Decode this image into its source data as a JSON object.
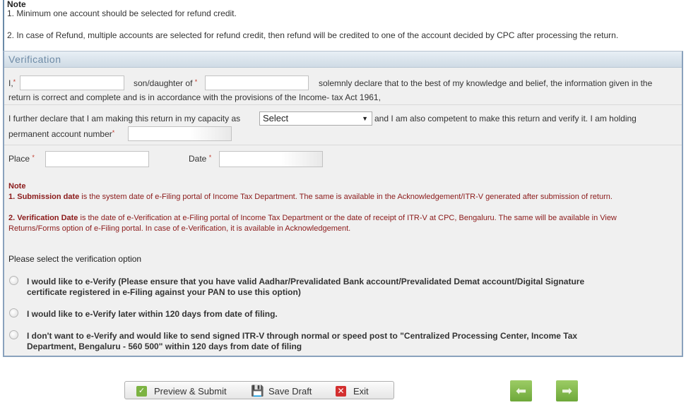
{
  "top_note": {
    "title": "Note",
    "lines": [
      "1. Minimum one account should be selected for refund credit.",
      "2. In case of Refund, multiple accounts are selected for refund credit, then refund will be credited to one of the account decided by CPC after processing the return."
    ]
  },
  "verification": {
    "header": "Verification",
    "declaration": {
      "i_label": "I,",
      "son_daughter_label": "son/daughter of",
      "solemnly_text": "solemnly declare that to the best of my knowledge and belief, the information given in the",
      "line2": "return is correct and complete and is in accordance with the provisions of the Income- tax Act 1961,",
      "name_value": "",
      "parent_value": ""
    },
    "capacity": {
      "text_before": "I further declare that I am making this return in my capacity as",
      "select_value": "Select",
      "text_after": "and I am also competent to make this return and verify it. I am holding",
      "pan_label": "permanent account number",
      "pan_value": ""
    },
    "place_label": "Place",
    "place_value": "",
    "date_label": "Date",
    "date_value": "",
    "required_marker": "*",
    "note": {
      "title": "Note",
      "item1_bold": "1. Submission date",
      "item1_rest": " is the system date of e-Filing portal of Income Tax Department. The same is available in the Acknowledgement/ITR-V generated after submission of return.",
      "item2_bold": "2. Verification Date",
      "item2_rest_line1": " is the date of e-Verification at e-Filing portal of Income Tax Department or the date of receipt of ITR-V at CPC, Bengaluru. The same will be available in View",
      "item2_line2": "Returns/Forms option of e-Filing portal. In case of e-Verification, it is available in Acknowledgement."
    },
    "options_title": "Please select the verification option",
    "options": [
      {
        "line1": "I would like to e-Verify (Please ensure that you have valid Aadhar/Prevalidated Bank account/Prevalidated Demat account/Digital Signature",
        "line2": "certificate registered in e-Filing against your PAN to use this option)",
        "selected": false
      },
      {
        "line1": "I would like to e-Verify later within 120 days from date of filing.",
        "line2": "",
        "selected": false
      },
      {
        "line1": "I don't want to e-Verify and would like to send signed ITR-V through normal or speed post to \"Centralized Processing Center, Income Tax",
        "line2": "Department, Bengaluru - 560 500\" within 120 days from date of filing",
        "selected": false
      }
    ]
  },
  "actions": {
    "preview_submit": "Preview & Submit",
    "save_draft": "Save Draft",
    "exit": "Exit",
    "prev_icon": "arrow-left-icon",
    "next_icon": "arrow-right-icon"
  },
  "colors": {
    "header_text": "#6d8aa5",
    "note_red": "#8b1a1a",
    "nav_green": "#7cb342"
  }
}
